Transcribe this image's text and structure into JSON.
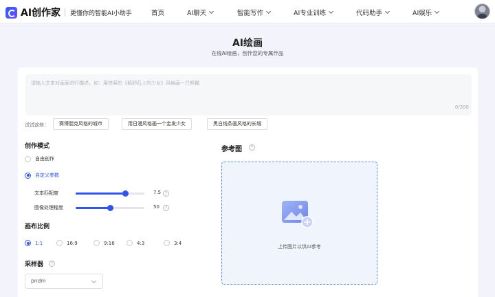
{
  "header": {
    "logo_title": "AI创作家",
    "slogan": "更懂你的智能AI小助手",
    "nav": [
      {
        "label": "首页",
        "has_dropdown": false
      },
      {
        "label": "AI聊天",
        "has_dropdown": true
      },
      {
        "label": "智能写作",
        "has_dropdown": true
      },
      {
        "label": "AI专业训练",
        "has_dropdown": true
      },
      {
        "label": "代码助手",
        "has_dropdown": true
      },
      {
        "label": "AI娱乐",
        "has_dropdown": true
      }
    ]
  },
  "page": {
    "title": "AI绘画",
    "subtitle": "在线AI绘画，创作您的专属作品"
  },
  "prompt": {
    "placeholder": "请输入文本对画面进行描述，如：用侠客的《鹅卵石上的少女》风格画一只熊猫",
    "char_count": "0/300"
  },
  "try": {
    "label": "试试这些：",
    "chips": [
      "赛博朋克风格的城市",
      "用日漫风格画一个金发少女",
      "黑白线条画风格的长城"
    ]
  },
  "mode": {
    "title": "创作模式",
    "options": [
      {
        "label": "自由创作",
        "selected": false
      },
      {
        "label": "自定义参数",
        "selected": true
      }
    ]
  },
  "sliders": [
    {
      "label": "文本匹配度",
      "value": "7.5",
      "fraction": 0.72
    },
    {
      "label": "图像处理程度",
      "value": "50",
      "fraction": 0.5
    }
  ],
  "ratio": {
    "title": "画布比例",
    "options": [
      {
        "label": "1:1",
        "selected": true
      },
      {
        "label": "16:9",
        "selected": false
      },
      {
        "label": "9:16",
        "selected": false
      },
      {
        "label": "4:3",
        "selected": false
      },
      {
        "label": "3:4",
        "selected": false
      }
    ]
  },
  "sampler": {
    "title": "采样器",
    "value": "pndm"
  },
  "reference": {
    "title": "参考图",
    "upload_text": "上传图片以供AI参考"
  },
  "colors": {
    "accent": "#2f54eb",
    "upload_border": "#4d8be6",
    "page_bg": "#f3f4fb"
  }
}
